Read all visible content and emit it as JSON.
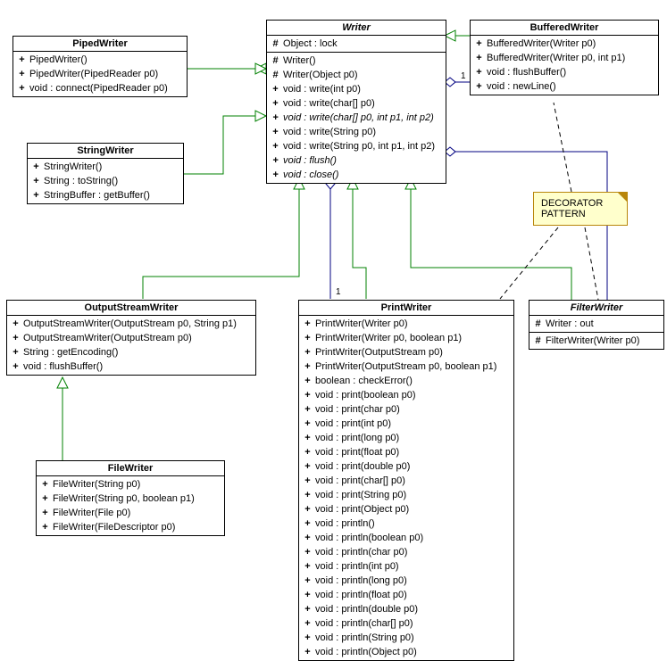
{
  "note": {
    "line1": "DECORATOR",
    "line2": "PATTERN"
  },
  "classes": {
    "Writer": {
      "name": "Writer",
      "abstract": true,
      "attrs": [
        {
          "vis": "#",
          "text": "Object : lock"
        }
      ],
      "ops": [
        {
          "vis": "#",
          "text": "Writer()"
        },
        {
          "vis": "#",
          "text": "Writer(Object p0)"
        },
        {
          "vis": "+",
          "text": "void : write(int p0)"
        },
        {
          "vis": "+",
          "text": "void : write(char[] p0)"
        },
        {
          "vis": "+",
          "text": "void : write(char[] p0, int p1, int p2)",
          "abstract": true
        },
        {
          "vis": "+",
          "text": "void : write(String p0)"
        },
        {
          "vis": "+",
          "text": "void : write(String p0, int p1, int p2)"
        },
        {
          "vis": "+",
          "text": "void : flush()",
          "abstract": true
        },
        {
          "vis": "+",
          "text": "void : close()",
          "abstract": true
        }
      ]
    },
    "PipedWriter": {
      "name": "PipedWriter",
      "ops": [
        {
          "vis": "+",
          "text": "PipedWriter()"
        },
        {
          "vis": "+",
          "text": "PipedWriter(PipedReader p0)"
        },
        {
          "vis": "+",
          "text": "void : connect(PipedReader p0)"
        }
      ]
    },
    "StringWriter": {
      "name": "StringWriter",
      "ops": [
        {
          "vis": "+",
          "text": "StringWriter()"
        },
        {
          "vis": "+",
          "text": "String : toString()"
        },
        {
          "vis": "+",
          "text": "StringBuffer : getBuffer()"
        }
      ]
    },
    "BufferedWriter": {
      "name": "BufferedWriter",
      "ops": [
        {
          "vis": "+",
          "text": "BufferedWriter(Writer p0)"
        },
        {
          "vis": "+",
          "text": "BufferedWriter(Writer p0, int p1)"
        },
        {
          "vis": "+",
          "text": "void : flushBuffer()"
        },
        {
          "vis": "+",
          "text": "void : newLine()"
        }
      ]
    },
    "OutputStreamWriter": {
      "name": "OutputStreamWriter",
      "ops": [
        {
          "vis": "+",
          "text": "OutputStreamWriter(OutputStream p0, String p1)"
        },
        {
          "vis": "+",
          "text": "OutputStreamWriter(OutputStream p0)"
        },
        {
          "vis": "+",
          "text": "String : getEncoding()"
        },
        {
          "vis": "+",
          "text": "void : flushBuffer()"
        }
      ]
    },
    "FileWriter": {
      "name": "FileWriter",
      "ops": [
        {
          "vis": "+",
          "text": "FileWriter(String p0)"
        },
        {
          "vis": "+",
          "text": "FileWriter(String p0, boolean p1)"
        },
        {
          "vis": "+",
          "text": "FileWriter(File p0)"
        },
        {
          "vis": "+",
          "text": "FileWriter(FileDescriptor p0)"
        }
      ]
    },
    "PrintWriter": {
      "name": "PrintWriter",
      "ops": [
        {
          "vis": "+",
          "text": "PrintWriter(Writer p0)"
        },
        {
          "vis": "+",
          "text": "PrintWriter(Writer p0, boolean p1)"
        },
        {
          "vis": "+",
          "text": "PrintWriter(OutputStream p0)"
        },
        {
          "vis": "+",
          "text": "PrintWriter(OutputStream p0, boolean p1)"
        },
        {
          "vis": "+",
          "text": "boolean : checkError()"
        },
        {
          "vis": "+",
          "text": "void : print(boolean p0)"
        },
        {
          "vis": "+",
          "text": "void : print(char p0)"
        },
        {
          "vis": "+",
          "text": "void : print(int p0)"
        },
        {
          "vis": "+",
          "text": "void : print(long p0)"
        },
        {
          "vis": "+",
          "text": "void : print(float p0)"
        },
        {
          "vis": "+",
          "text": "void : print(double p0)"
        },
        {
          "vis": "+",
          "text": "void : print(char[] p0)"
        },
        {
          "vis": "+",
          "text": "void : print(String p0)"
        },
        {
          "vis": "+",
          "text": "void : print(Object p0)"
        },
        {
          "vis": "+",
          "text": "void : println()"
        },
        {
          "vis": "+",
          "text": "void : println(boolean p0)"
        },
        {
          "vis": "+",
          "text": "void : println(char p0)"
        },
        {
          "vis": "+",
          "text": "void : println(int p0)"
        },
        {
          "vis": "+",
          "text": "void : println(long p0)"
        },
        {
          "vis": "+",
          "text": "void : println(float p0)"
        },
        {
          "vis": "+",
          "text": "void : println(double p0)"
        },
        {
          "vis": "+",
          "text": "void : println(char[] p0)"
        },
        {
          "vis": "+",
          "text": "void : println(String p0)"
        },
        {
          "vis": "+",
          "text": "void : println(Object p0)"
        }
      ]
    },
    "FilterWriter": {
      "name": "FilterWriter",
      "abstract": true,
      "attrs": [
        {
          "vis": "#",
          "text": "Writer : out"
        }
      ],
      "ops": [
        {
          "vis": "#",
          "text": "FilterWriter(Writer p0)"
        }
      ]
    }
  },
  "cardinality": {
    "buffered": "1",
    "printwriter": "1"
  }
}
